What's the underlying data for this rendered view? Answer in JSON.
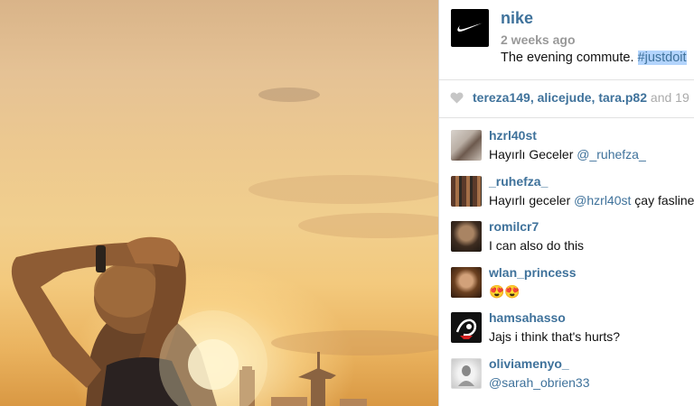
{
  "post": {
    "photo_alt": "Runner stretching arms overhead at sunset",
    "username": "nike",
    "timestamp": "2 weeks ago",
    "caption_text": "The evening commute.",
    "caption_hashtag": "#justdoit",
    "logo_icon": "nike-swoosh-icon"
  },
  "likes": {
    "icon": "heart-icon",
    "users": [
      "tereza149",
      "alicejude",
      "tara.p82"
    ],
    "separator": ",",
    "conjunction": "and",
    "more": "19"
  },
  "comments": [
    {
      "username": "hzrl40st",
      "text": "Hayırlı Geceler",
      "mention": "@_ruhefza_"
    },
    {
      "username": "_ruhefza_",
      "text": "Hayırlı geceler",
      "mention": "@hzrl40st",
      "trailing": "çay fasline"
    },
    {
      "username": "romilcr7",
      "text": "I can also do this"
    },
    {
      "username": "wlan_princess",
      "text": "😍😍"
    },
    {
      "username": "hamsahasso",
      "text": "Jajs i think that's hurts?"
    },
    {
      "username": "oliviamenyo_",
      "mention_only": "@sarah_obrien33"
    }
  ],
  "colors": {
    "link": "#3f729b",
    "text": "#111111",
    "muted": "#999999",
    "highlight": "#b3d4fc"
  }
}
